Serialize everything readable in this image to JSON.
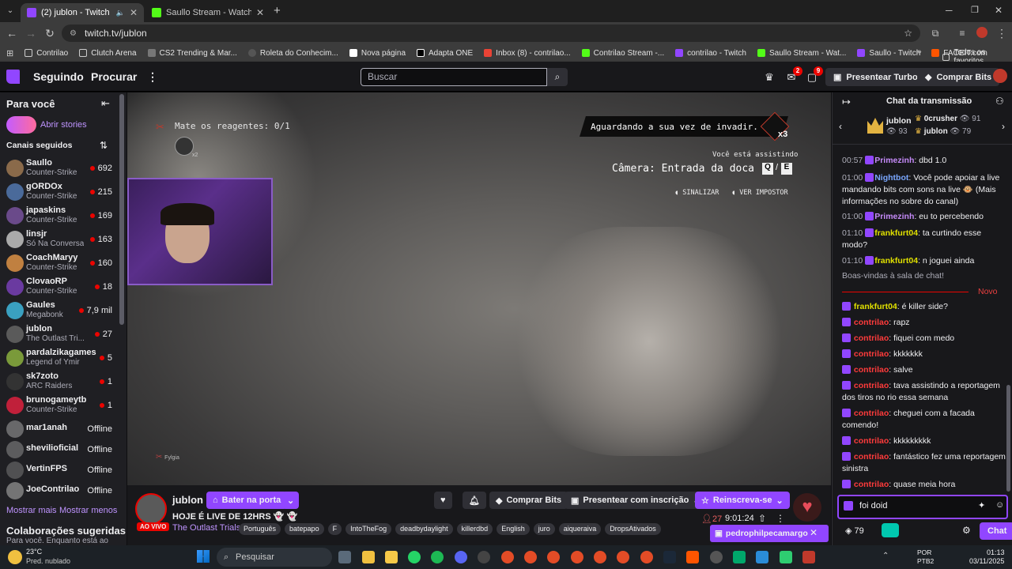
{
  "browser": {
    "tabs": [
      {
        "title": "(2) jublon - Twitch",
        "active": true,
        "color": "#9146ff"
      },
      {
        "title": "Saullo Stream - Watch Live on K",
        "active": false,
        "color": "#53fc18"
      }
    ],
    "new_tab": "+",
    "url": "twitch.tv/jublon",
    "bookmarks": [
      {
        "label": "Contrilao",
        "color": "#e3b341"
      },
      {
        "label": "Clutch Arena",
        "color": "#e3b341"
      },
      {
        "label": "CS2 Trending & Mar...",
        "color": "#cccccc"
      },
      {
        "label": "Roleta do Conhecim...",
        "color": "#cccccc"
      },
      {
        "label": "Nova página",
        "color": "#ffffff"
      },
      {
        "label": "Adapta ONE",
        "color": "#ffffff"
      },
      {
        "label": "Inbox (8) - contrilao...",
        "color": "#ea4335"
      },
      {
        "label": "Contrilao Stream -...",
        "color": "#53fc18"
      },
      {
        "label": "contrilao - Twitch",
        "color": "#9146ff"
      },
      {
        "label": "Saullo Stream - Wat...",
        "color": "#53fc18"
      },
      {
        "label": "Saullo - Twitch",
        "color": "#9146ff"
      },
      {
        "label": "FACEIT.com",
        "color": "#ff5500"
      }
    ],
    "all_favorites": "Todos os favoritos"
  },
  "topnav": {
    "following": "Seguindo",
    "browse": "Procurar",
    "search_placeholder": "Buscar",
    "inbox_badge": "2",
    "notif_badge": "9",
    "turbo": "Presentear Turbo",
    "bits": "Comprar Bits"
  },
  "sidebar": {
    "for_you": "Para você",
    "stories": "Abrir stories",
    "followed": "Canais seguidos",
    "channels": [
      {
        "name": "Saullo",
        "game": "Counter-Strike",
        "viewers": "692",
        "color": "#8a6a4a"
      },
      {
        "name": "gORDOx",
        "game": "Counter-Strike",
        "viewers": "215",
        "color": "#4a6a9a"
      },
      {
        "name": "japaskins",
        "game": "Counter-Strike",
        "viewers": "169",
        "color": "#6a4a8a"
      },
      {
        "name": "linsjr",
        "game": "Só Na Conversa",
        "viewers": "163",
        "color": "#aaaaaa"
      },
      {
        "name": "CoachMaryy",
        "game": "Counter-Strike",
        "viewers": "160",
        "color": "#c08040"
      },
      {
        "name": "ClovaoRP",
        "game": "Counter-Strike",
        "viewers": "18",
        "color": "#6a3aa0"
      },
      {
        "name": "Gaules",
        "game": "Megabonk",
        "viewers": "7,9 mil",
        "color": "#3aa0c0"
      },
      {
        "name": "jublon",
        "game": "The Outlast Tri...",
        "viewers": "27",
        "color": "#5a5a5a"
      },
      {
        "name": "pardalzikagames",
        "game": "Legend of Ymir",
        "viewers": "5",
        "color": "#7a9a3a"
      },
      {
        "name": "sk7zoto",
        "game": "ARC Raiders",
        "viewers": "1",
        "color": "#333333"
      },
      {
        "name": "brunogameytb",
        "game": "Counter-Strike",
        "viewers": "1",
        "color": "#c0203a"
      }
    ],
    "offline": [
      {
        "name": "mar1anah",
        "status": "Offline",
        "color": "#888888"
      },
      {
        "name": "shevilioficial",
        "status": "Offline",
        "color": "#777777"
      },
      {
        "name": "VertinFPS",
        "status": "Offline",
        "color": "#666666"
      },
      {
        "name": "JoeContrilao",
        "status": "Offline",
        "color": "#999999"
      }
    ],
    "show_more": "Mostrar mais",
    "show_less": "Mostrar menos",
    "collabs_title": "Colaborações sugeridas",
    "collabs_sub": "Para você. Enquanto está ao"
  },
  "video": {
    "objective": "Mate os reagentes: 0/1",
    "objective_count": "x2",
    "waiting": "Aguardando a sua vez de invadir.",
    "waiting_count": "x3",
    "watching": "Você está assistindo",
    "camera": "Câmera: Entrada da doca",
    "key_q": "Q",
    "key_e": "E",
    "signal": "SINALIZAR",
    "impostor": "VER IMPOSTOR",
    "player_tag": "Fylgia"
  },
  "stream": {
    "channel": "jublon",
    "knock": "Bater na porta",
    "live": "AO VIVO",
    "title": "HOJE É LIVE DE 12HRS 👻 👻",
    "game": "The Outlast Trials",
    "tags": [
      "Português",
      "batepapo",
      "F",
      "IntoTheFog",
      "deadbydaylight",
      "killerdbd",
      "English",
      "juro",
      "aiqueraiva",
      "DropsAtivados"
    ],
    "buy_bits": "Comprar Bits",
    "gift_sub": "Presentear com inscrição",
    "resub": "Reinscreva-se",
    "viewers": "27",
    "uptime": "9:01:24"
  },
  "chat": {
    "title": "Chat da transmissão",
    "leader": {
      "name": "jublon",
      "score": "93"
    },
    "ranks": [
      {
        "name": "0crusher",
        "score": "91"
      },
      {
        "name": "jublon",
        "score": "79"
      }
    ],
    "messages": [
      {
        "ts": "00:57",
        "user": "Primezinh",
        "color": "#c58af9",
        "text": "dbd 1.0"
      },
      {
        "ts": "01:00",
        "user": "Nightbot",
        "color": "#7aa7ff",
        "text": "Você pode apoiar a live mandando bits com sons na live 🐵 (Mais informações no sobre do canal)"
      },
      {
        "ts": "01:00",
        "user": "Primezinh",
        "color": "#c58af9",
        "text": "eu to percebendo"
      },
      {
        "ts": "01:10",
        "user": "frankfurt04",
        "color": "#e0e000",
        "text": "ta curtindo esse modo?"
      },
      {
        "ts": "01:10",
        "user": "frankfurt04",
        "color": "#e0e000",
        "text": "n joguei ainda"
      }
    ],
    "welcome": "Boas-vindas à sala de chat!",
    "new_label": "Novo",
    "new_messages": [
      {
        "user": "frankfurt04",
        "color": "#e0e000",
        "text": "é killer side?"
      },
      {
        "user": "contrilao",
        "color": "#ff3b3b",
        "text": "rapz"
      },
      {
        "user": "contrilao",
        "color": "#ff3b3b",
        "text": "fiquei com medo"
      },
      {
        "user": "contrilao",
        "color": "#ff3b3b",
        "text": "kkkkkkk"
      },
      {
        "user": "contrilao",
        "color": "#ff3b3b",
        "text": "salve"
      },
      {
        "user": "contrilao",
        "color": "#ff3b3b",
        "text": "tava assistindo a reportagem dos tiros no rio essa semana"
      },
      {
        "user": "contrilao",
        "color": "#ff3b3b",
        "text": "cheguei com a facada comendo!"
      },
      {
        "user": "contrilao",
        "color": "#ff3b3b",
        "text": "kkkkkkkkk"
      },
      {
        "user": "contrilao",
        "color": "#ff3b3b",
        "text": "fantástico fez uma reportagem sinistra"
      },
      {
        "user": "contrilao",
        "color": "#ff3b3b",
        "text": "quase meia hora"
      }
    ],
    "input_value": "foi doid",
    "points": "79",
    "send": "Chat",
    "popup_user": "pedrophilpecamargo"
  },
  "taskbar": {
    "temp": "23°C",
    "weather": "Pred. nublado",
    "search": "Pesquisar",
    "lang": "POR",
    "kb": "PTB2",
    "time": "01:13",
    "date": "03/11/2025"
  },
  "colors": {
    "brand": "#9146ff",
    "live": "#eb0400"
  }
}
